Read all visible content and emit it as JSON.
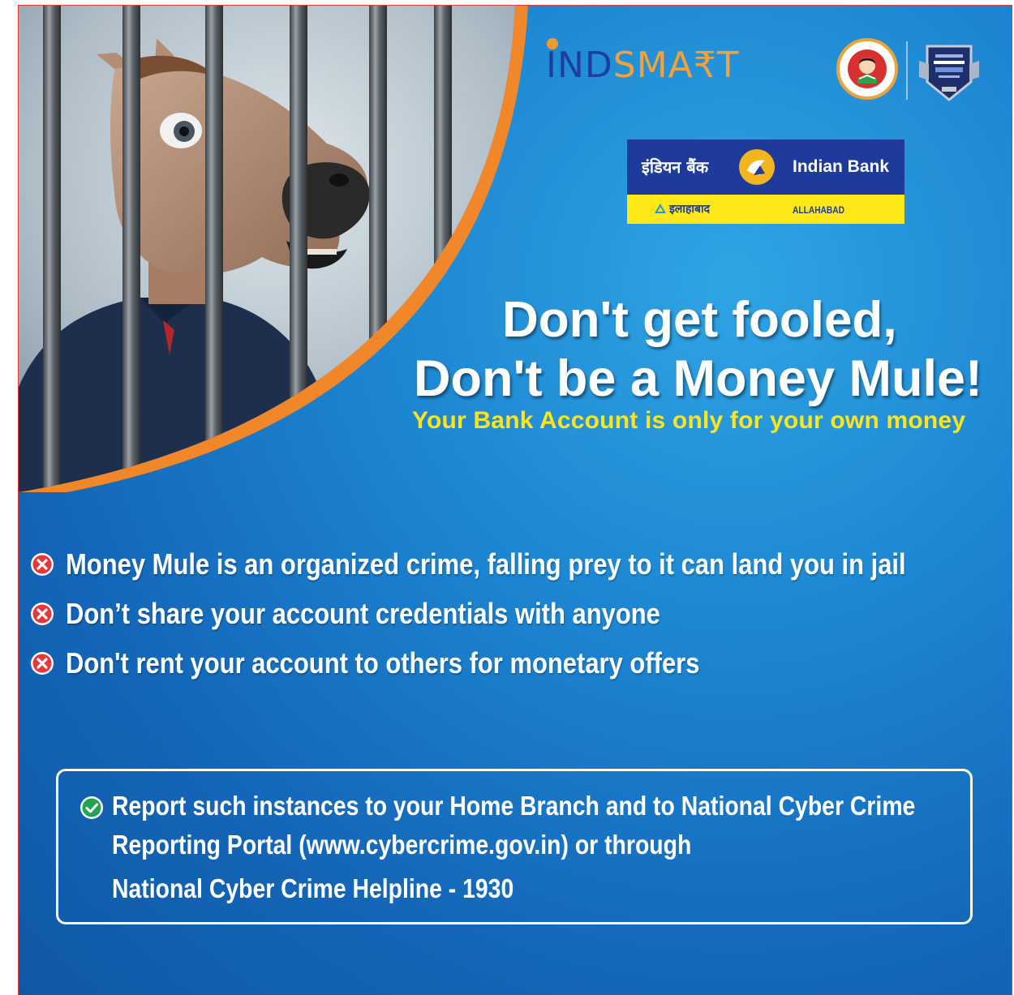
{
  "brand": {
    "indsmart_part1": "IND",
    "indsmart_part2": "SMA₹T"
  },
  "bank": {
    "name_hindi": "इंडियन बैंक",
    "name_english": "Indian Bank",
    "merged_hindi": "इलाहाबाद",
    "merged_english": "ALLAHABAD"
  },
  "headline": {
    "line1": "Don't get fooled,",
    "line2": "Don't be a Money Mule!",
    "tagline": "Your Bank Account is only for your own money"
  },
  "warnings": [
    {
      "text": "Money Mule is an organized crime, falling prey to it can land you in jail",
      "icon": "x-circle-icon"
    },
    {
      "text": "Don’t share your account credentials with anyone",
      "icon": "x-circle-icon"
    },
    {
      "text": "Don't rent your account to others for monetary offers",
      "icon": "x-circle-icon"
    }
  ],
  "report": {
    "line1": "Report such instances to your Home Branch and to National Cyber Crime",
    "line2": "Reporting Portal (www.cybercrime.gov.in) or through",
    "line3": "National Cyber Crime Helpline - 1930",
    "icon": "check-circle-icon"
  },
  "colors": {
    "background_blue": "#1d86d2",
    "accent_orange": "#f2872a",
    "tagline_yellow": "#ffe51a",
    "bank_blue": "#1e3a9a",
    "bank_yellow": "#ffe815",
    "warning_red": "#e8373b",
    "check_green": "#23a455"
  }
}
